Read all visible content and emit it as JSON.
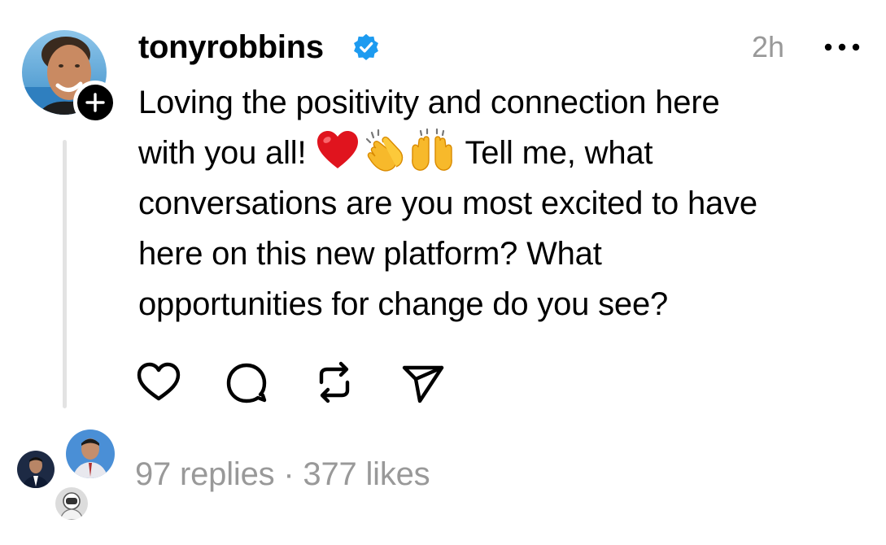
{
  "post": {
    "username": "tonyrobbins",
    "verified": true,
    "timestamp": "2h",
    "text_lines": [
      "Loving the positivity and connection here",
      "with you all!",
      " Tell me, what",
      "conversations are you most excited to have",
      "here on this new platform? What",
      "opportunities for change do you see?"
    ],
    "emojis": [
      "red-heart-emoji",
      "clapping-hands-emoji",
      "raising-hands-emoji"
    ]
  },
  "actions": {
    "like": "heart-icon",
    "comment": "comment-icon",
    "repost": "repost-icon",
    "share": "send-icon"
  },
  "footer": {
    "replies": "97 replies",
    "separator": " · ",
    "likes": "377 likes"
  },
  "colors": {
    "verified": "#1d9bf0",
    "muted_text": "#999999",
    "thread_line": "#e3e3e3"
  }
}
